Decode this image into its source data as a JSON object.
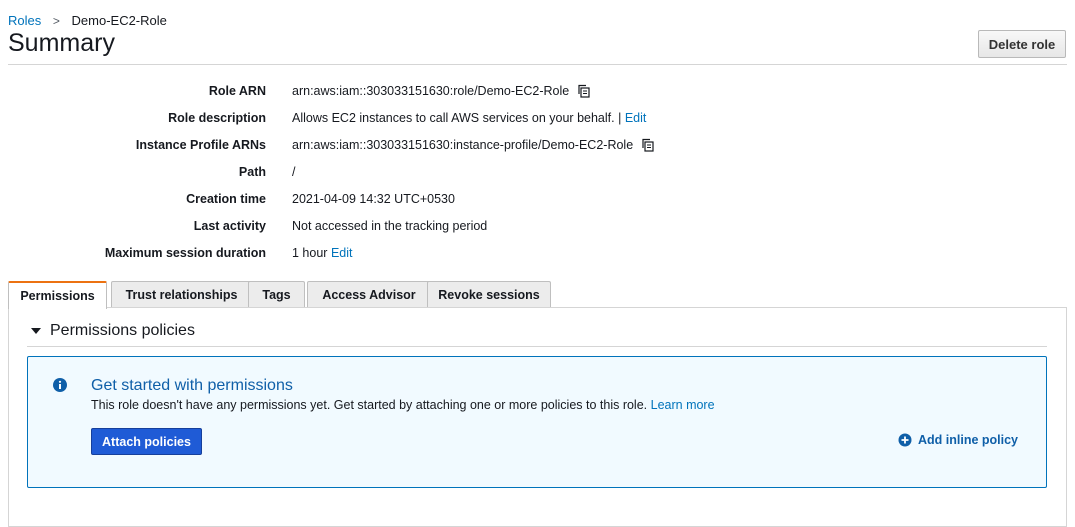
{
  "breadcrumb": {
    "parent": "Roles",
    "separator": ">",
    "current": "Demo-EC2-Role"
  },
  "page": {
    "title": "Summary",
    "delete_button": "Delete role"
  },
  "summary": [
    {
      "label": "Role ARN",
      "value": "arn:aws:iam::303033151630:role/Demo-EC2-Role",
      "copy": true
    },
    {
      "label": "Role description",
      "value": "Allows EC2 instances to call AWS services on your behalf. |",
      "link": "Edit"
    },
    {
      "label": "Instance Profile ARNs",
      "value": "arn:aws:iam::303033151630:instance-profile/Demo-EC2-Role",
      "copy": true
    },
    {
      "label": "Path",
      "value": "/"
    },
    {
      "label": "Creation time",
      "value": "2021-04-09 14:32 UTC+0530"
    },
    {
      "label": "Last activity",
      "value": "Not accessed in the tracking period"
    },
    {
      "label": "Maximum session duration",
      "value": "1 hour",
      "link": "Edit"
    }
  ],
  "tabs": [
    {
      "label": "Permissions",
      "active": true
    },
    {
      "label": "Trust relationships"
    },
    {
      "label": "Tags"
    },
    {
      "label": "Access Advisor"
    },
    {
      "label": "Revoke sessions"
    }
  ],
  "permissions": {
    "section_title": "Permissions policies",
    "info_title": "Get started with permissions",
    "info_text": "This role doesn't have any permissions yet. Get started by attaching one or more policies to this role.",
    "learn_more": "Learn more",
    "attach_button": "Attach policies",
    "inline_policy": "Add inline policy"
  },
  "colors": {
    "accent": "#ec7211",
    "link": "#0073bb",
    "primary_button": "#1f5bd6",
    "info_bg": "#f1faff"
  },
  "icons": {
    "copy": "copy-icon",
    "info": "info-icon",
    "caret": "caret-down-icon",
    "add": "plus-circle-icon"
  }
}
